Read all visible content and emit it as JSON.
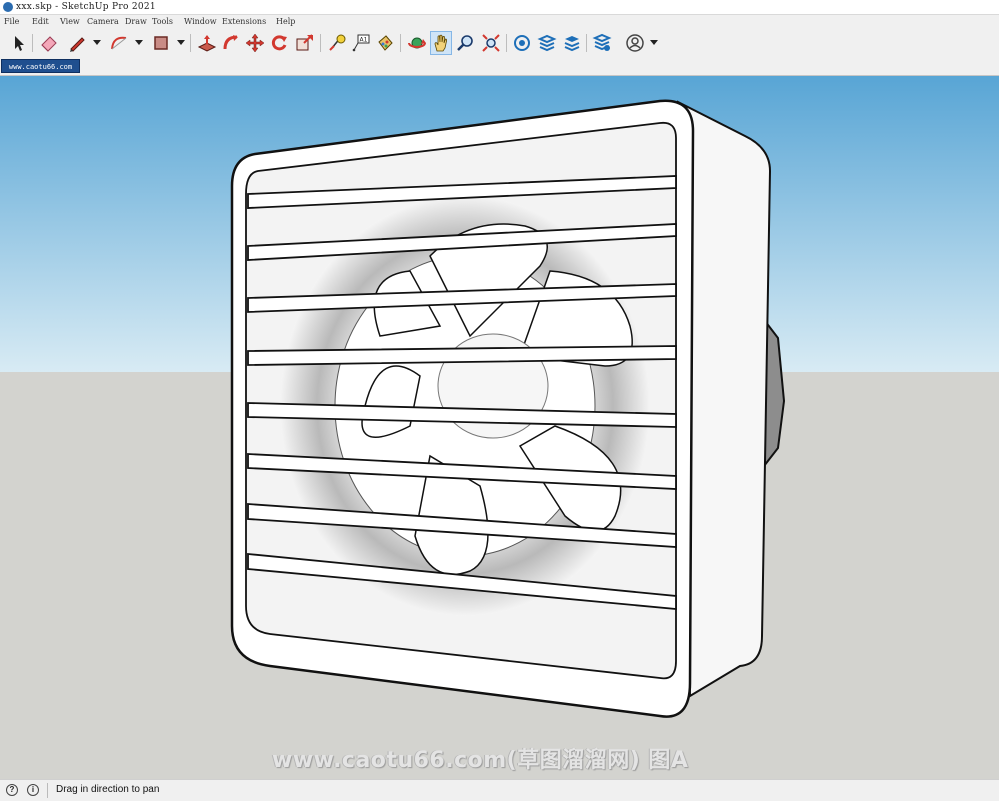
{
  "window": {
    "title": "xxx.skp - SketchUp Pro 2021"
  },
  "menu": [
    "File",
    "Edit",
    "View",
    "Camera",
    "Draw",
    "Tools",
    "Window",
    "Extensions",
    "Help"
  ],
  "toolbar": {
    "tools": [
      {
        "name": "select",
        "icon": "arrow-cursor-icon"
      },
      {
        "name": "eraser",
        "icon": "eraser-icon"
      },
      {
        "name": "line",
        "icon": "pencil-icon"
      },
      {
        "name": "arc",
        "icon": "arc-icon"
      },
      {
        "name": "shapes",
        "icon": "rectangle-icon"
      },
      {
        "name": "push-pull",
        "icon": "push-pull-icon"
      },
      {
        "name": "follow-me",
        "icon": "follow-me-icon"
      },
      {
        "name": "move",
        "icon": "move-icon"
      },
      {
        "name": "rotate",
        "icon": "rotate-icon"
      },
      {
        "name": "scale",
        "icon": "scale-icon"
      },
      {
        "name": "tape-measure",
        "icon": "tape-measure-icon"
      },
      {
        "name": "text",
        "icon": "text-icon",
        "label": "A1"
      },
      {
        "name": "paint-bucket",
        "icon": "paint-bucket-icon"
      },
      {
        "name": "orbit",
        "icon": "orbit-icon"
      },
      {
        "name": "pan",
        "icon": "pan-hand-icon",
        "active": true
      },
      {
        "name": "zoom",
        "icon": "zoom-icon"
      },
      {
        "name": "zoom-extents",
        "icon": "zoom-extents-icon"
      },
      {
        "name": "3d-warehouse",
        "icon": "warehouse-icon"
      },
      {
        "name": "extension-warehouse",
        "icon": "extension-warehouse-icon"
      },
      {
        "name": "layout",
        "icon": "layout-icon"
      },
      {
        "name": "extension-manager",
        "icon": "extension-manager-icon"
      },
      {
        "name": "account",
        "icon": "account-icon"
      }
    ]
  },
  "tab": {
    "label": "www.caotu66.com"
  },
  "watermark": {
    "text": "www.caotu66.com(草图溜溜网) 图A"
  },
  "status": {
    "message": "Drag in direction to pan"
  },
  "colors": {
    "sky_top": "#5aa6d6",
    "sky_bottom": "#d8ebf4",
    "ground": "#d3d3cf",
    "accent": "#1f4f8f"
  }
}
